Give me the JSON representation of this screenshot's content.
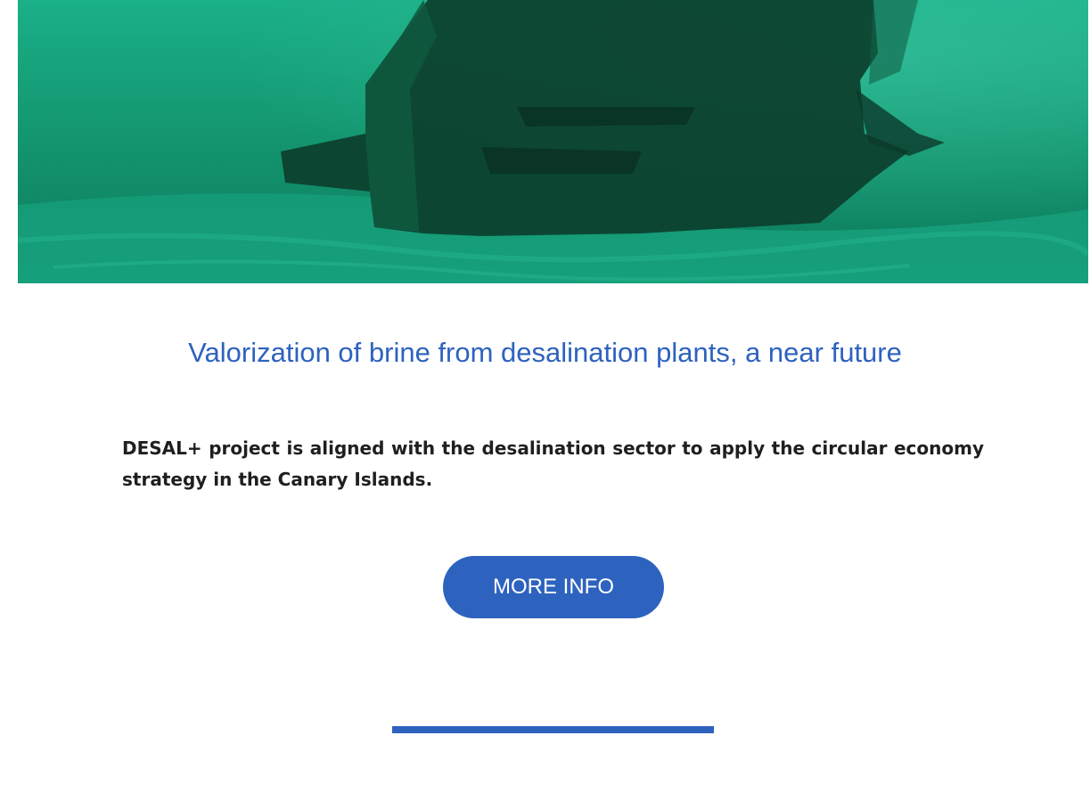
{
  "article": {
    "title": "Valorization of brine from desalination plants, a near future",
    "intro": "DESAL+ project is aligned with the desalination sector to apply the circular economy strategy in the Canary Islands.",
    "more_label": "MORE INFO"
  },
  "colors": {
    "accent": "#2e62bf",
    "text": "#1f1f1f",
    "water": "#14956f"
  }
}
